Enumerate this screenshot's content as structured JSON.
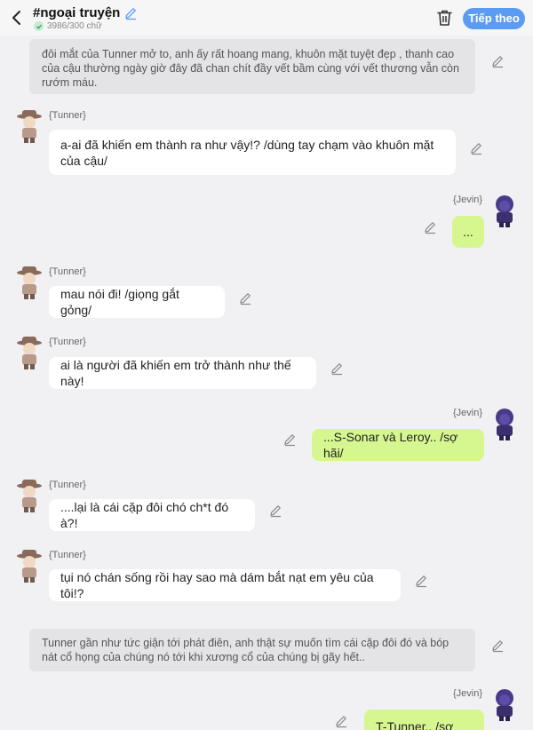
{
  "header": {
    "title": "#ngoại truyện",
    "word_count": "3986/300 chữ",
    "follow_label": "Tiếp theo"
  },
  "colors": {
    "accent": "#5b9cf2",
    "self_bubble": "#d6f78f",
    "other_bubble": "#ffffff",
    "narration_bg": "#e4e4e7"
  },
  "messages": [
    {
      "type": "narration",
      "text": "đôi mắt của Tunner mở to, anh ấy rất hoang mang, khuôn mặt tuyệt đẹp , thanh cao của cậu thường ngày giờ đây đã chan chít đầy vết bầm cùng với vết thương vẫn còn rướm máu."
    },
    {
      "type": "left",
      "name": "{Tunner}",
      "text": "a-ai đã khiến em thành ra như vậy!? /dùng tay chạm vào khuôn mặt của cậu/"
    },
    {
      "type": "right",
      "name": "{Jevin}",
      "text": "..."
    },
    {
      "type": "left",
      "name": "{Tunner}",
      "text": "mau nói đi! /giọng gắt gỏng/"
    },
    {
      "type": "left",
      "name": "{Tunner}",
      "text": "ai là người đã khiến em trở thành như thế này!"
    },
    {
      "type": "right",
      "name": "{Jevin}",
      "text": "...S-Sonar và Leroy.. /sợ hãi/"
    },
    {
      "type": "left",
      "name": "{Tunner}",
      "text": "....lại là cái cặp đôi chó ch*t đó à?!"
    },
    {
      "type": "left",
      "name": "{Tunner}",
      "text": "tụi nó chán sống rồi hay sao mà dám bắt nạt em yêu của tôi!?"
    },
    {
      "type": "narration",
      "text": "Tunner gần như tức giận tới phát điên, anh thật sự muốn tìm cái cặp đôi đó và bóp nát cổ họng của chúng nó tới khi xương cổ của chúng bị gãy hết.."
    },
    {
      "type": "right",
      "name": "{Jevin}",
      "text": "T-Tunner.. /sợ hãi/"
    }
  ]
}
